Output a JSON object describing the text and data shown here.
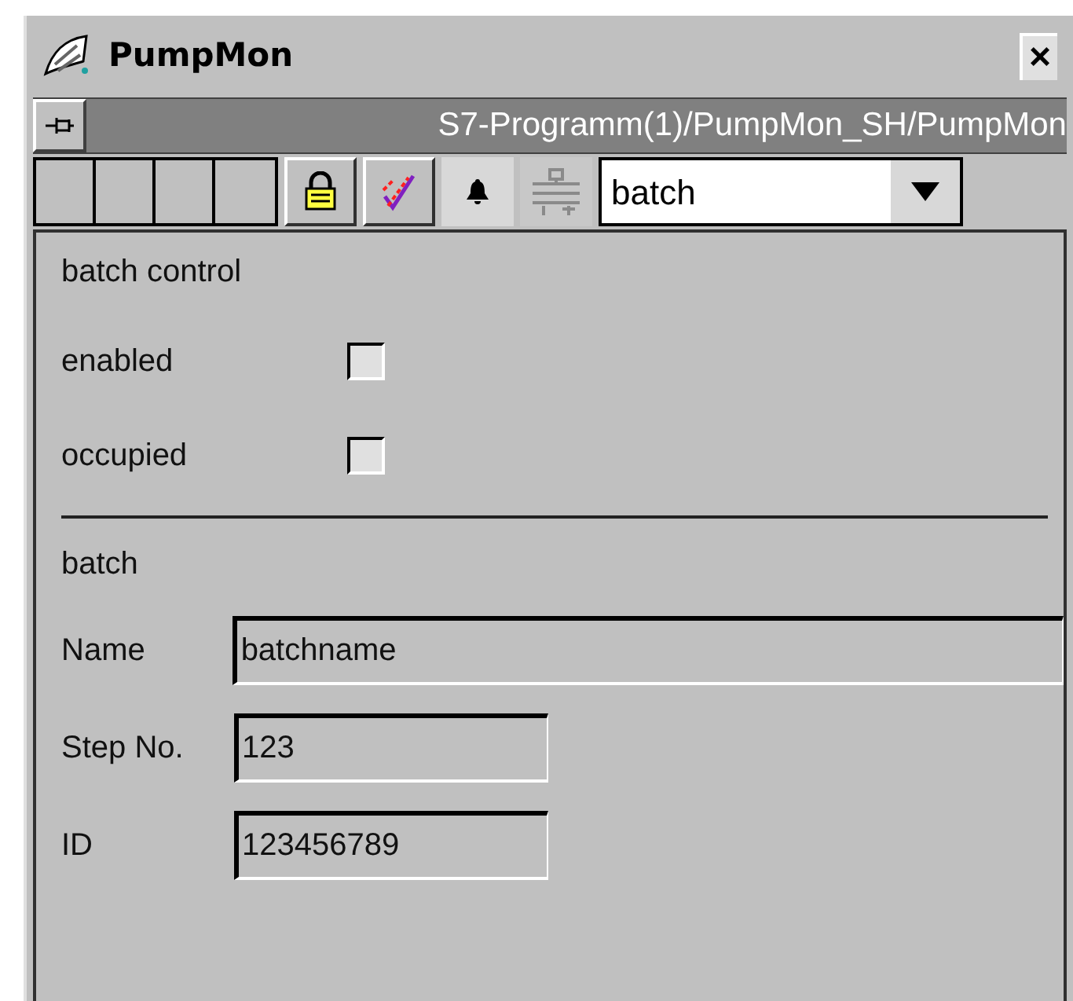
{
  "window": {
    "title": "PumpMon",
    "close": "×"
  },
  "path_bar": {
    "path": "S7-Programm(1)/PumpMon_SH/PumpMon"
  },
  "toolbar": {
    "tools": [
      {
        "kind": "lock",
        "disabled": false
      },
      {
        "kind": "check",
        "disabled": false
      },
      {
        "kind": "bell",
        "disabled": false
      },
      {
        "kind": "sliders",
        "disabled": true
      }
    ],
    "dropdown": {
      "value": "batch"
    }
  },
  "batch_control": {
    "heading": "batch control",
    "checkboxes": [
      {
        "label": "enabled",
        "checked": false
      },
      {
        "label": "occupied",
        "checked": false
      }
    ]
  },
  "batch": {
    "heading": "batch",
    "fields": [
      {
        "label": "Name",
        "value": "batchname",
        "kind": "wide"
      },
      {
        "label": "Step No.",
        "value": "123",
        "kind": "narrow"
      },
      {
        "label": "ID",
        "value": "123456789",
        "kind": "narrow"
      }
    ]
  }
}
